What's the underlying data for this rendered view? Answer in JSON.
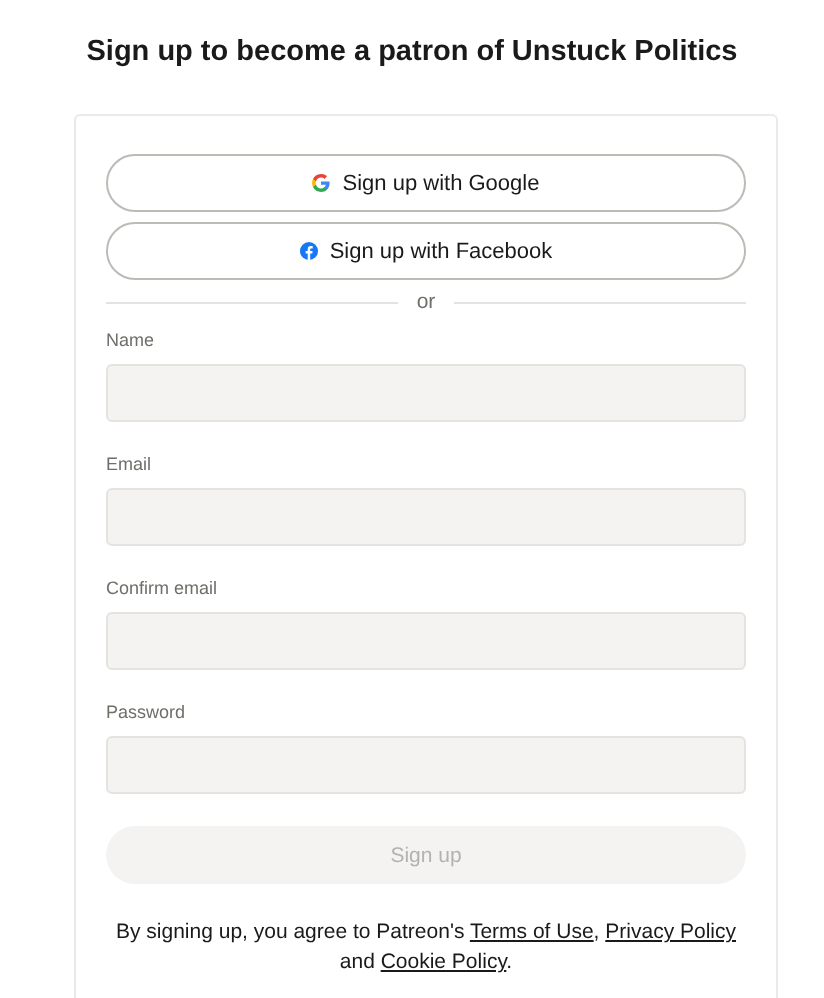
{
  "title": "Sign up to become a patron of Unstuck Politics",
  "social_buttons": [
    {
      "kind": "google",
      "label": "Sign up with Google"
    },
    {
      "kind": "facebook",
      "label": "Sign up with Facebook"
    }
  ],
  "divider": "or",
  "fields": [
    {
      "label": "Name"
    },
    {
      "label": "Email"
    },
    {
      "label": "Confirm email"
    },
    {
      "label": "Password"
    }
  ],
  "submit": {
    "label": "Sign up",
    "disabled": true
  },
  "legal": [
    {
      "kind": "text",
      "text": "By signing up, you agree to Patreon's "
    },
    {
      "kind": "link",
      "text": "Terms of Use"
    },
    {
      "kind": "text",
      "text": ", "
    },
    {
      "kind": "link",
      "text": "Privacy Policy"
    },
    {
      "kind": "text",
      "text": " and "
    },
    {
      "kind": "link",
      "text": "Cookie Policy"
    },
    {
      "kind": "text",
      "text": "."
    }
  ]
}
